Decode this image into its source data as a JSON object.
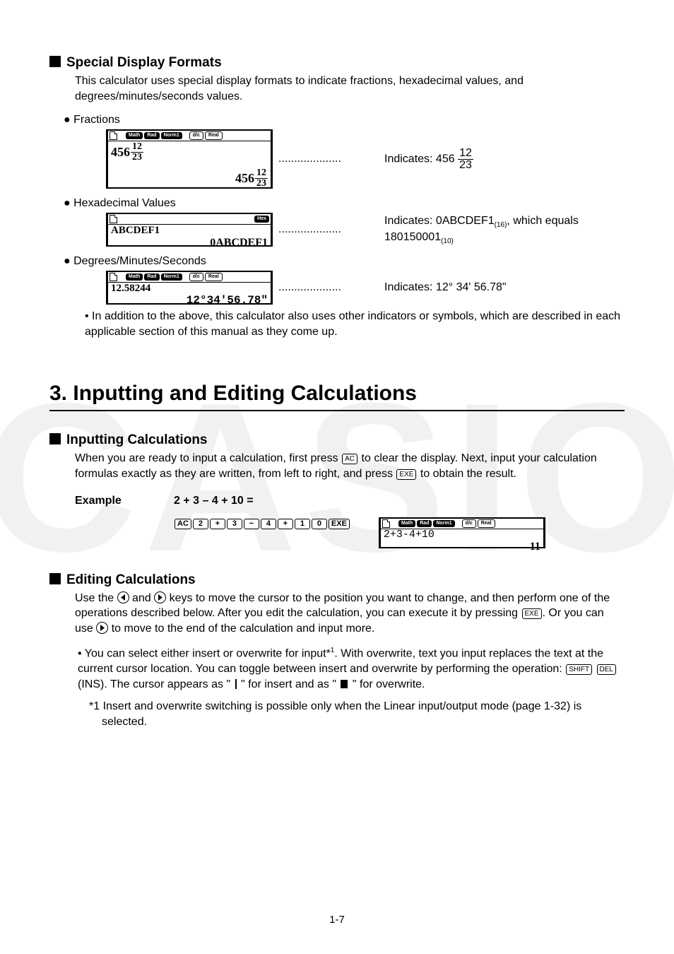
{
  "watermark": "CASIO",
  "section1": {
    "title": "Special Display Formats",
    "intro": "This calculator uses special display formats to indicate fractions, hexadecimal values, and degrees/minutes/seconds values.",
    "fractions_label": "Fractions",
    "fractions_input": "456",
    "fractions_num": "12",
    "fractions_den": "23",
    "fractions_result_whole": "456",
    "fractions_result_num": "12",
    "fractions_result_den": "23",
    "fractions_desc_prefix": "Indicates: 456 ",
    "fractions_desc_num": "12",
    "fractions_desc_den": "23",
    "hex_label": "Hexadecimal Values",
    "hex_input": "ABCDEF1",
    "hex_result": "0ABCDEF1",
    "hex_desc_line1a": "Indicates: 0ABCDEF1",
    "hex_desc_line1b": "(16)",
    "hex_desc_line1c": ", which equals",
    "hex_desc_line2a": "180150001",
    "hex_desc_line2b": "(10)",
    "dms_label": "Degrees/Minutes/Seconds",
    "dms_input": "12.58244",
    "dms_result": "12°34'56.78\"",
    "dms_desc": "Indicates: 12° 34' 56.78\"",
    "note": "In addition to the above, this calculator also uses other indicators or symbols, which are described in each applicable section of this manual as they come up.",
    "dots": "...................."
  },
  "chapter": "3. Inputting and Editing Calculations",
  "section2": {
    "title": "Inputting Calculations",
    "body_a": "When you are ready to input a calculation, first press ",
    "body_b": " to clear the display. Next, input your calculation formulas exactly as they are written, from left to right, and press ",
    "body_c": " to obtain the result.",
    "example_label": "Example",
    "example_eq": "2 + 3 – 4 + 10 =",
    "keys": [
      "AC",
      "2",
      "+",
      "3",
      "−",
      "4",
      "+",
      "1",
      "0",
      "EXE"
    ],
    "screen_input": "2+3-4+10",
    "screen_result": "11"
  },
  "section3": {
    "title": "Editing Calculations",
    "body_a": "Use the ",
    "body_b": " and ",
    "body_c": " keys to move the cursor to the position you want to change, and then perform one of the operations described below. After you edit the calculation, you can execute it by pressing ",
    "body_d": ". Or you can use ",
    "body_e": " to move to the end of the calculation and input more.",
    "bullet_a": "You can select either insert or overwrite for input*",
    "bullet_a_sup": "1",
    "bullet_a2": ". With overwrite, text you input replaces the text at the current cursor location. You can toggle between insert and overwrite by performing the operation: ",
    "bullet_a_ins": "(INS). The cursor appears as \" ",
    "bullet_a_mid": " \" for insert and as \" ",
    "bullet_a_end": " \" for overwrite.",
    "footnote_mark": "*1",
    "footnote": " Insert and overwrite switching is possible only when the Linear input/output mode (page 1-32) is selected."
  },
  "status_badges": {
    "math": "Math",
    "rad": "Rad",
    "norm1": "Norm1",
    "dc": "d/c",
    "real": "Real",
    "hex": "Hex"
  },
  "keys_inline": {
    "ac": "AC",
    "exe": "EXE",
    "shift": "SHIFT",
    "del": "DEL"
  },
  "page_number": "1-7"
}
